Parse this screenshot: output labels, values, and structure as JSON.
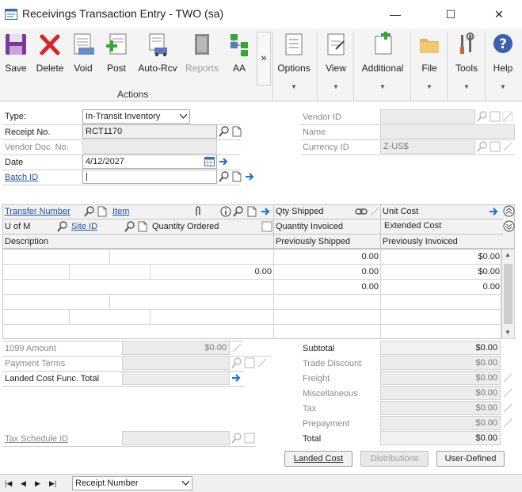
{
  "window": {
    "title": "Receivings Transaction Entry  -  TWO (sa)",
    "minimize": "—",
    "maximize": "☐",
    "close": "✕"
  },
  "ribbon": {
    "buttons": [
      {
        "label": "Save",
        "icon": "save-icon"
      },
      {
        "label": "Delete",
        "icon": "delete-icon"
      },
      {
        "label": "Void",
        "icon": "void-icon"
      },
      {
        "label": "Post",
        "icon": "post-icon"
      },
      {
        "label": "Auto-Rcv",
        "icon": "auto-receive-icon"
      },
      {
        "label": "Reports",
        "icon": "reports-icon"
      },
      {
        "label": "AA",
        "icon": "aa-icon"
      }
    ],
    "group_label": "Actions",
    "more": "»",
    "menus": [
      {
        "label": "Options",
        "icon": "options-icon"
      },
      {
        "label": "View",
        "icon": "view-icon"
      },
      {
        "label": "Additional",
        "icon": "additional-icon"
      },
      {
        "label": "File",
        "icon": "file-icon"
      },
      {
        "label": "Tools",
        "icon": "tools-icon"
      },
      {
        "label": "Help",
        "icon": "help-icon"
      }
    ],
    "drop": "▼"
  },
  "header": {
    "type_label": "Type:",
    "type_value": "In-Transit Inventory",
    "receipt_label": "Receipt No.",
    "receipt_value": "RCT1170",
    "vendor_doc_label": "Vendor Doc. No.",
    "date_label": "Date",
    "date_value": "4/12/2027",
    "batch_label": "Batch ID",
    "batch_value": "|",
    "vendor_id_label": "Vendor ID",
    "name_label": "Name",
    "currency_label": "Currency ID",
    "currency_value": "Z-US$"
  },
  "grid": {
    "transfer_number": "Transfer Number",
    "item": "Item",
    "qty_shipped": "Qty Shipped",
    "unit_cost": "Unit Cost",
    "u_of_m": "U of M",
    "site_id": "Site ID",
    "qty_ordered": "Quantity Ordered",
    "qty_invoiced": "Quantity Invoiced",
    "extended_cost": "Extended Cost",
    "description": "Description",
    "prev_shipped": "Previously Shipped",
    "prev_invoiced": "Previously Invoiced",
    "rows": [
      {
        "prev_shipped": "0.00",
        "prev_invoiced": "$0.00"
      },
      {
        "qty_ordered": "0.00",
        "qty_invoiced": "0.00",
        "extended": "$0.00"
      },
      {
        "prev_shipped": "0.00",
        "prev_invoiced": "0.00"
      }
    ]
  },
  "footer": {
    "amount_1099_label": "1099 Amount",
    "amount_1099_value": "$0.00",
    "payment_terms_label": "Payment Terms",
    "landed_cost_label": "Landed Cost Func. Total",
    "tax_schedule_label": "Tax Schedule ID",
    "subtotal_label": "Subtotal",
    "subtotal_value": "$0.00",
    "trade_discount_label": "Trade Discount",
    "trade_discount_value": "$0.00",
    "freight_label": "Freight",
    "freight_value": "$0.00",
    "misc_label": "Miscellaneous",
    "misc_value": "$0.00",
    "tax_label": "Tax",
    "tax_value": "$0.00",
    "prepayment_label": "Prepayment",
    "prepayment_value": "$0.00",
    "total_label": "Total",
    "total_value": "$0.00",
    "btn_landed_cost": "Landed Cost",
    "btn_distributions": "Distributions",
    "btn_user_defined": "User-Defined"
  },
  "status": {
    "sort_value": "Receipt Number",
    "first": "|◀",
    "prev": "◀",
    "next": "▶",
    "last": "▶|"
  },
  "colors": {
    "accent": "#1f6fd1",
    "link": "#1f4fa8"
  }
}
